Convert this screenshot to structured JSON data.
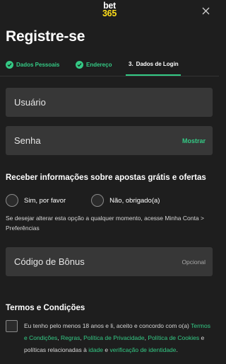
{
  "header": {
    "logo_line1": "bet",
    "logo_line2": "365",
    "close_icon": "close-icon",
    "title": "Registre-se"
  },
  "steps": {
    "items": [
      {
        "label": "Dados Pessoais",
        "status": "done",
        "icon": "check-icon"
      },
      {
        "label": "Endereço",
        "status": "done",
        "icon": "check-icon"
      },
      {
        "number": "3.",
        "label": "Dados de Login",
        "status": "active"
      }
    ]
  },
  "form": {
    "username": {
      "placeholder": "Usuário",
      "value": ""
    },
    "password": {
      "placeholder": "Senha",
      "value": "",
      "show_label": "Mostrar"
    },
    "offers": {
      "heading": "Receber informações sobre apostas grátis e ofertas",
      "option_yes": "Sim, por favor",
      "option_no": "Não, obrigado(a)",
      "note": "Se desejar alterar esta opção a qualquer momento, acesse Minha Conta > Preferências"
    },
    "bonus": {
      "placeholder": "Código de Bônus",
      "optional_label": "Opcional",
      "value": ""
    },
    "terms": {
      "heading": "Termos e Condições",
      "text_intro": "Eu tenho pelo menos 18 anos e li, aceito e concordo com o(a) ",
      "link_terms": "Termos e Condições",
      "sep1": ", ",
      "link_rules": "Regras",
      "sep2": ", ",
      "link_privacy": "Política de Privacidade",
      "sep3": ", ",
      "link_cookies": "Política de Cookies",
      "text_middle": " e políticas relacionadas à ",
      "link_age": "idade",
      "text_and": " e ",
      "link_identity": "verificação de identidade",
      "text_end": "."
    }
  },
  "colors": {
    "background": "#1e1e1e",
    "field": "#373737",
    "accent": "#34ca85",
    "logo_yellow": "#ffdf1b"
  }
}
